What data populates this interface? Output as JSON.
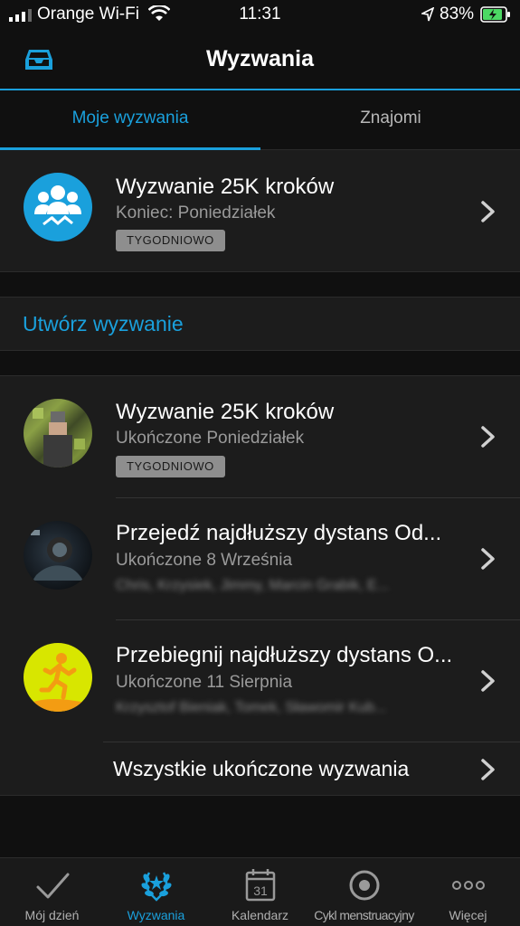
{
  "status": {
    "carrier": "Orange Wi-Fi",
    "time": "11:31",
    "battery_pct": "83%"
  },
  "header": {
    "title": "Wyzwania",
    "left_icon": "inbox-icon"
  },
  "tabs": [
    {
      "label": "Moje wyzwania",
      "active": true
    },
    {
      "label": "Znajomi",
      "active": false
    }
  ],
  "active_challenge": {
    "title": "Wyzwanie 25K kroków",
    "subtitle": "Koniec: Poniedziałek",
    "badge": "TYGODNIOWO",
    "icon": "group-challenge-icon"
  },
  "create": {
    "label": "Utwórz wyzwanie"
  },
  "completed": [
    {
      "title": "Wyzwanie 25K kroków",
      "subtitle": "Ukończone Poniedziałek",
      "badge": "TYGODNIOWO",
      "participants": ""
    },
    {
      "title": "Przejedź najdłuższy dystans Od...",
      "subtitle": "Ukończone 8 Września",
      "badge": "",
      "participants": "Chris, Krzysiek, Jimmy, Marcin Grabik, E..."
    },
    {
      "title": "Przebiegnij najdłuższy dystans O...",
      "subtitle": "Ukończone 11 Sierpnia",
      "badge": "",
      "participants": "Krzysztof Bieniak, Tomek, Sławomir Kub..."
    }
  ],
  "all_completed": {
    "label": "Wszystkie ukończone wyzwania"
  },
  "tabbar": [
    {
      "label": "Mój dzień",
      "icon": "checkmark-icon",
      "active": false
    },
    {
      "label": "Wyzwania",
      "icon": "laurel-icon",
      "active": true
    },
    {
      "label": "Kalendarz",
      "icon": "calendar-icon",
      "calendar_day": "31",
      "active": false
    },
    {
      "label": "Cykl menstruacyjny",
      "icon": "cycle-icon",
      "active": false
    },
    {
      "label": "Więcej",
      "icon": "more-icon",
      "active": false
    }
  ],
  "colors": {
    "accent": "#1aa0dc",
    "background": "#101010",
    "card": "#1c1c1c",
    "running_icon_bg": "#d8e600",
    "running_icon_fg": "#f39c12"
  }
}
